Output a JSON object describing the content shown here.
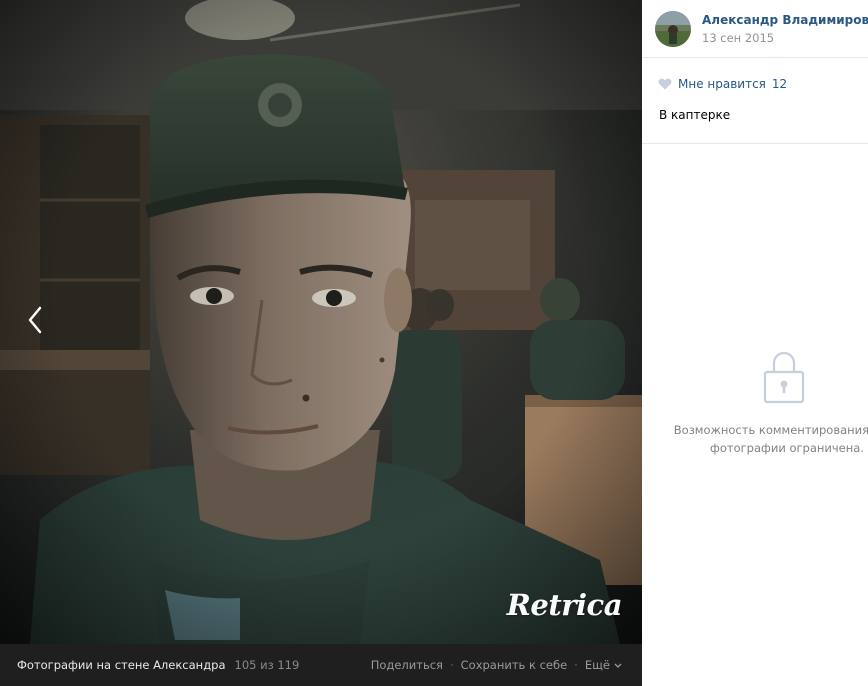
{
  "viewer": {
    "album_title": "Фотографии на стене Александра",
    "counter": "105 из 119",
    "actions": {
      "share": "Поделиться",
      "save": "Сохранить к себе",
      "more": "Ещё"
    },
    "watermark": "Retrica"
  },
  "post": {
    "author_name": "Александр Владимирович",
    "date": "13 сен 2015",
    "likes_label": "Мне нравится",
    "likes_count": "12",
    "caption": "В каптерке",
    "comments_restricted": "Возможность комментирования этой фотографии ограничена."
  },
  "colors": {
    "link": "#2a5885",
    "meta": "#939393",
    "bar": "#1f1f1f",
    "icon": "#c5d0dc"
  },
  "icons": {
    "prev": "chevron-left-icon",
    "like": "heart-icon",
    "lock": "lock-icon",
    "more": "chevron-down-icon"
  }
}
